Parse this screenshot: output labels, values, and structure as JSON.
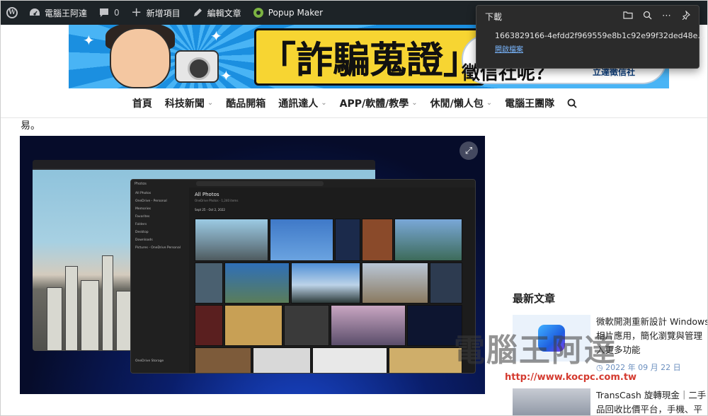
{
  "admin_bar": {
    "site_name": "電腦王阿達",
    "comments_count": "0",
    "new_item": "新增項目",
    "edit_post": "編輯文章",
    "popup_maker": "Popup Maker"
  },
  "banner": {
    "title": "「詐騙蒐證」",
    "subtitle": "徵信社呢？",
    "brand": "立達徵信社"
  },
  "nav": {
    "items": [
      {
        "label": "首頁",
        "has_menu": false
      },
      {
        "label": "科技新聞",
        "has_menu": true
      },
      {
        "label": "酷品開箱",
        "has_menu": false
      },
      {
        "label": "通訊達人",
        "has_menu": true
      },
      {
        "label": "APP/軟體/教學",
        "has_menu": true
      },
      {
        "label": "休閒/懶人包",
        "has_menu": true
      },
      {
        "label": "電腦王團隊",
        "has_menu": false
      }
    ]
  },
  "article": {
    "lead_char": "易。"
  },
  "screenshot": {
    "photos_title": "All Photos",
    "photos_subtitle": "OneDrive Photos - 1,240 items",
    "date_range": "Sept 25 - Oct 2, 2022",
    "sidebar_items": [
      "All Photos",
      "OneDrive - Personal",
      "Memories",
      "Favorites",
      "Folders",
      "Desktop",
      "Downloads",
      "Pictures - OneDrive Personal"
    ],
    "storage_label": "OneDrive Storage"
  },
  "downloads": {
    "title": "下載",
    "filename": "1663829166-4efdd2f969559e8b1c92e99f32ded48e...",
    "open_file": "開啟檔案"
  },
  "sidebar": {
    "heading": "最新文章",
    "posts": [
      {
        "title_line1": "微軟開測重新設計 Windows",
        "title_line2": "相片應用，簡化瀏覽與管理",
        "title_line3": "入更多功能",
        "date": "2022 年 09 月 22 日"
      },
      {
        "title_line1": "TransCash 旋轉現金｜二手",
        "title_line2": "品回收比價平台，手機、平"
      }
    ]
  },
  "watermark": {
    "text": "電腦王阿達",
    "url": "http://www.kocpc.com.tw"
  }
}
